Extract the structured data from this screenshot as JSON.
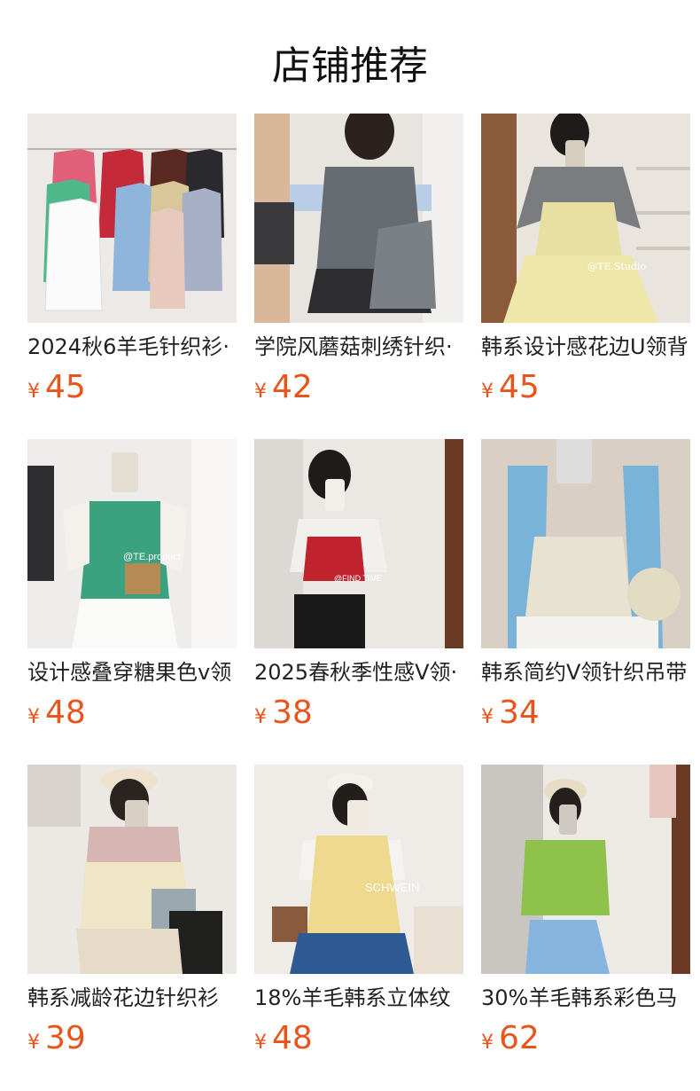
{
  "page": {
    "title": "店铺推荐"
  },
  "currency_symbol": "¥",
  "products": [
    {
      "name": "2024秋6羊毛针织衫·",
      "price": "45"
    },
    {
      "name": "学院风蘑菇刺绣针织·",
      "price": "42"
    },
    {
      "name": "韩系设计感花边U领背",
      "price": "45"
    },
    {
      "name": "设计感叠穿糖果色v领",
      "price": "48"
    },
    {
      "name": "2025春秋季性感V领·",
      "price": "38"
    },
    {
      "name": "韩系简约V领针织吊带",
      "price": "34"
    },
    {
      "name": "韩系减龄花边针织衫",
      "price": "39"
    },
    {
      "name": "18%羊毛韩系立体纹",
      "price": "48"
    },
    {
      "name": "30%羊毛韩系彩色马",
      "price": "62"
    }
  ],
  "image_overlays": {
    "p3_watermark": "@TE.Studio",
    "p4_watermark": "@TE.product",
    "p5_watermark": "@FIND TIME",
    "p8_logo": "SCHWEIN"
  }
}
